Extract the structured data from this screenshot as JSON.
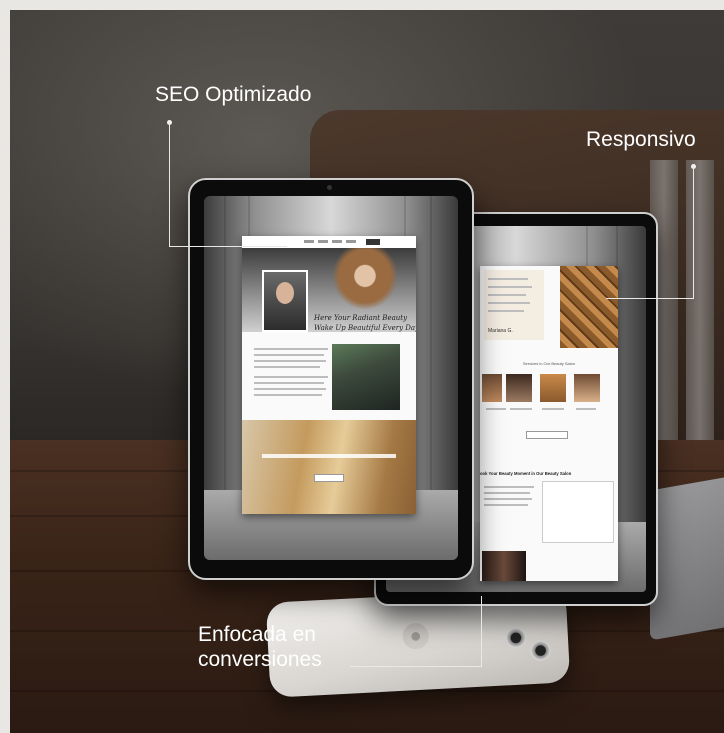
{
  "labels": {
    "seo": "SEO Optimizado",
    "responsive": "Responsivo",
    "conversions_line1": "Enfocada en",
    "conversions_line2": "conversiones"
  },
  "front_tablet": {
    "headline_line1": "Here Your Radiant Beauty",
    "headline_line2": "Wake Up Beautiful Every Day"
  },
  "back_tablet": {
    "services_heading": "Services in Our Beauty Salon",
    "booking_heading": "ook Your Beauty Moment in Our Beauty Salon",
    "testimonial_author": "Mariana G."
  },
  "colors": {
    "label_text": "#ffffff",
    "leader_line": "#e8e8e8",
    "tablet_frame": "#0b0b0b"
  }
}
